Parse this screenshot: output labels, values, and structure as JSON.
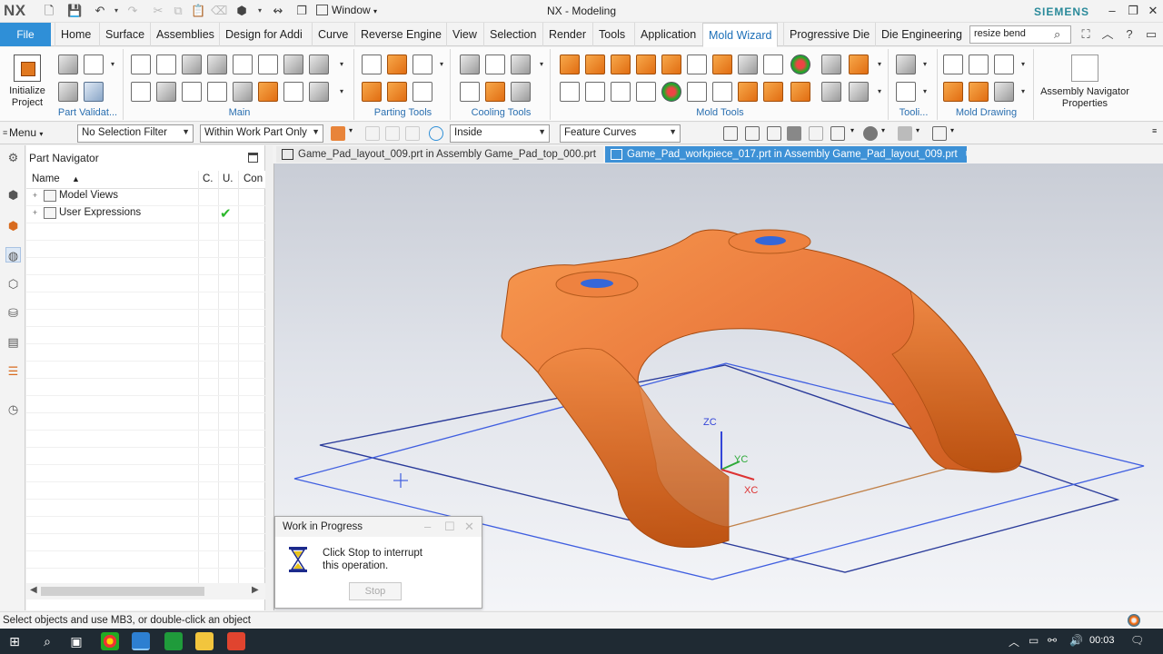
{
  "titlebar": {
    "logo": "NX",
    "window_menu": "Window",
    "title": "NX - Modeling",
    "brand": "SIEMENS"
  },
  "tabs": {
    "file": "File",
    "items": [
      "Home",
      "Surface",
      "Assemblies",
      "Design for Addi",
      "Curve",
      "Reverse Engine",
      "View",
      "Selection",
      "Render",
      "Tools",
      "Application",
      "Mold Wizard",
      "Progressive Die",
      "Die Engineering"
    ],
    "active": "Mold Wizard",
    "search_value": "resize bend"
  },
  "ribbon": {
    "init_project_line1": "Initialize",
    "init_project_line2": "Project",
    "groups": [
      "Part Validat...",
      "Main",
      "Parting Tools",
      "Cooling Tools",
      "Mold Tools",
      "Tooli...",
      "Mold Drawing"
    ],
    "asm_nav_line1": "Assembly Navigator",
    "asm_nav_line2": "Properties"
  },
  "selection_bar": {
    "menu": "Menu",
    "filter": "No Selection Filter",
    "scope": "Within Work Part Only",
    "inside": "Inside",
    "curve_rule": "Feature Curves"
  },
  "part_navigator": {
    "title": "Part Navigator",
    "columns": [
      "Name",
      "C.",
      "U.",
      "Con"
    ],
    "rows": [
      {
        "label": "Model Views",
        "checked": false
      },
      {
        "label": "User Expressions",
        "checked": true
      }
    ]
  },
  "doc_tabs": [
    {
      "label": "Game_Pad_layout_009.prt in Assembly Game_Pad_top_000.prt",
      "active": false
    },
    {
      "label": "Game_Pad_workpiece_017.prt in Assembly Game_Pad_layout_009.prt",
      "active": true
    }
  ],
  "viewport": {
    "axis_labels": {
      "z": "ZC",
      "y": "YC",
      "x": "XC"
    },
    "model_color": "#e8743a"
  },
  "wip_dialog": {
    "title": "Work in Progress",
    "message_line1": "Click Stop to interrupt",
    "message_line2": "this operation.",
    "stop_label": "Stop"
  },
  "status": {
    "text": "Select objects and use MB3, or double-click an object"
  },
  "taskbar": {
    "clock": "00:03"
  },
  "colors": {
    "accent": "#2f8fd7",
    "ribbon_label": "#2a6fb0",
    "model_orange": "#e8743a"
  }
}
